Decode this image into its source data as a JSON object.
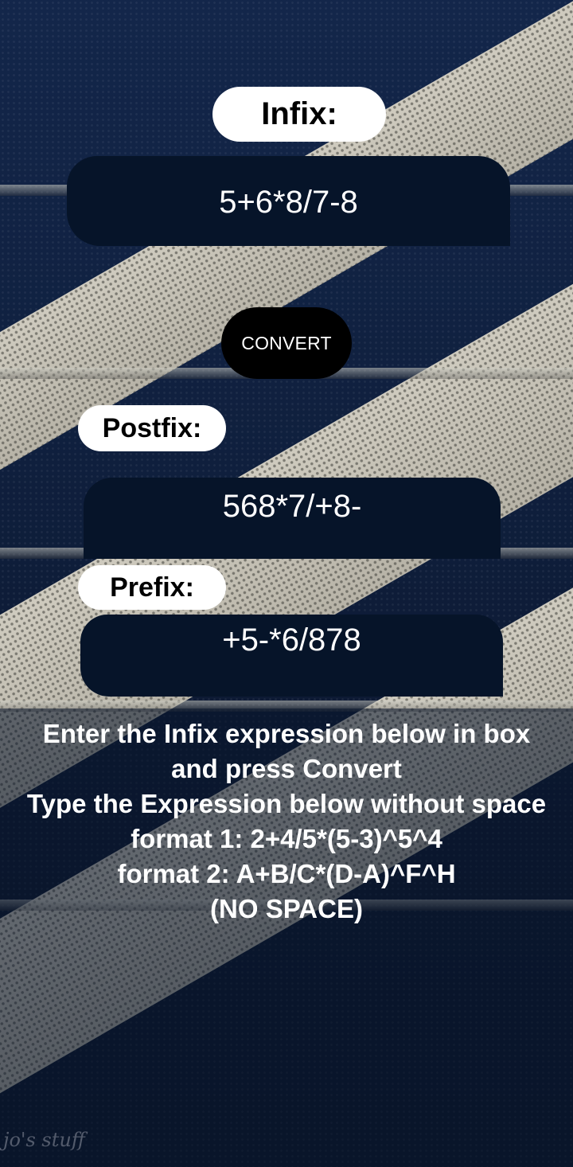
{
  "infix": {
    "label": "Infix:",
    "value": "5+6*8/7-8"
  },
  "convert_button": {
    "label": "CONVERT"
  },
  "postfix": {
    "label": "Postfix:",
    "value": "568*7/+8-"
  },
  "prefix": {
    "label": "Prefix:",
    "value": "+5-*6/878"
  },
  "instructions": {
    "line1": "Enter the Infix expression below in box",
    "line2": "and press Convert",
    "line3": "Type the Expression below without space",
    "line4": "format 1: 2+4/5*(5-3)^5^4",
    "line5": "format 2: A+B/C*(D-A)^F^H",
    "line6": "(NO SPACE)"
  },
  "watermark": {
    "text": "jo's stuff"
  }
}
